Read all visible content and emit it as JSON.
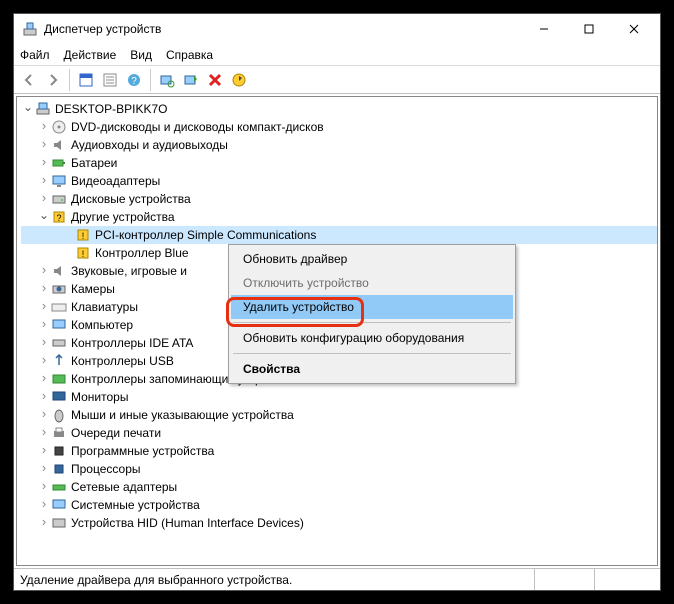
{
  "window": {
    "title": "Диспетчер устройств"
  },
  "menu": {
    "file": "Файл",
    "action": "Действие",
    "view": "Вид",
    "help": "Справка"
  },
  "tree": {
    "root": "DESKTOP-BPIKK7O",
    "n_dvd": "DVD-дисководы и дисководы компакт-дисков",
    "n_audio": "Аудиовходы и аудиовыходы",
    "n_battery": "Батареи",
    "n_video": "Видеоадаптеры",
    "n_disk": "Дисковые устройства",
    "n_other": "Другие устройства",
    "n_other_c1": "PCI-контроллер Simple Communications",
    "n_other_c2": "Контроллер Blue",
    "n_sound": "Звуковые, игровые и",
    "n_camera": "Камеры",
    "n_keyboard": "Клавиатуры",
    "n_computer": "Компьютер",
    "n_ide": "Контроллеры IDE ATA",
    "n_usb": "Контроллеры USB",
    "n_storage": "Контроллеры запоминающих устройств",
    "n_monitor": "Мониторы",
    "n_mouse": "Мыши и иные указывающие устройства",
    "n_printq": "Очереди печати",
    "n_software": "Программные устройства",
    "n_cpu": "Процессоры",
    "n_net": "Сетевые адаптеры",
    "n_system": "Системные устройства",
    "n_hid": "Устройства HID (Human Interface Devices)"
  },
  "ctx": {
    "update": "Обновить драйвер",
    "disable": "Отключить устройство",
    "remove": "Удалить устройство",
    "rescan": "Обновить конфигурацию оборудования",
    "props": "Свойства"
  },
  "status": {
    "text": "Удаление драйвера для выбранного устройства."
  }
}
